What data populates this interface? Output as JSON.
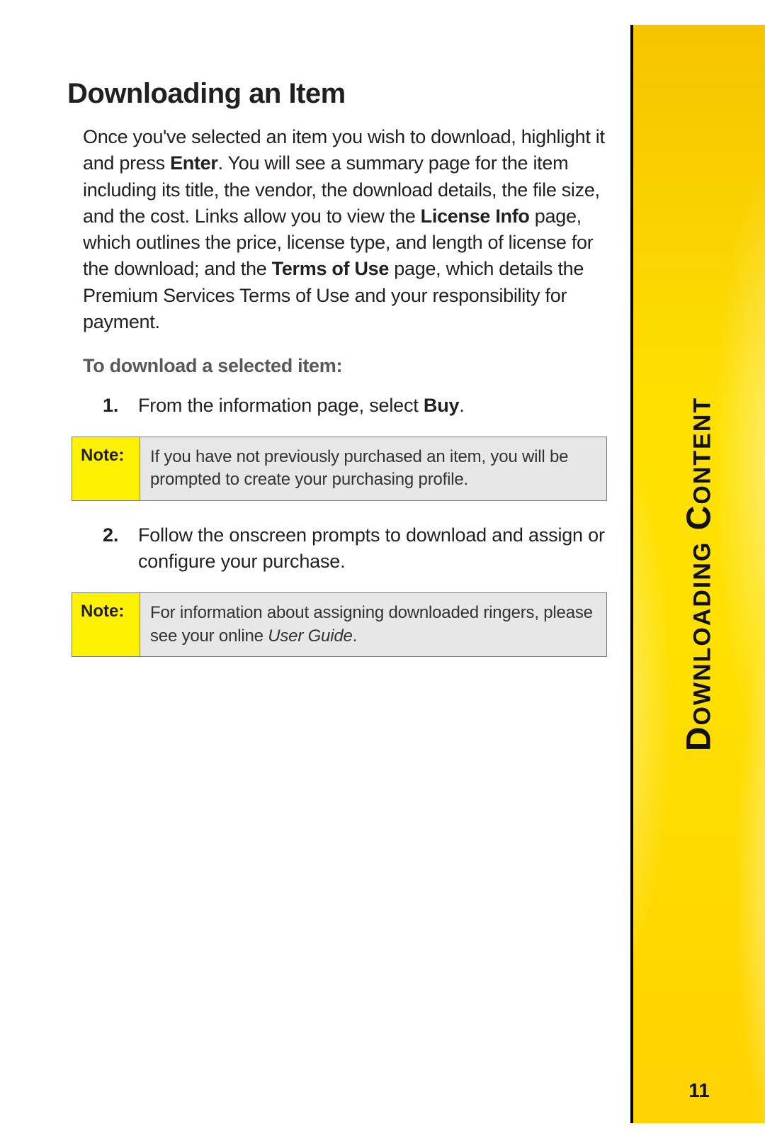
{
  "sidebar": {
    "section_label": "Downloading Content",
    "page_number": "11"
  },
  "heading": "Downloading an Item",
  "intro": {
    "seg1": "Once you've selected an item you wish to download, highlight it and press ",
    "bold1": "Enter",
    "seg2": ". You will see a summary page for the item including its title, the vendor, the download details, the file size, and the cost. Links allow you to view the ",
    "bold2": "License Info",
    "seg3": " page, which outlines the price, license type, and length of license for the download; and the ",
    "bold3": "Terms of Use",
    "seg4": " page, which details the Premium Services Terms of Use and your responsibility for payment."
  },
  "subhead": "To download a selected item:",
  "steps": [
    {
      "num": "1.",
      "pre": "From the information page, select ",
      "bold": "Buy",
      "post": "."
    },
    {
      "num": "2.",
      "pre": "Follow the onscreen prompts to download and assign or configure your purchase.",
      "bold": "",
      "post": ""
    }
  ],
  "notes": [
    {
      "label": "Note:",
      "text_pre": "If you have not previously purchased an item, you will be prompted to create your purchasing profile.",
      "italic": "",
      "text_post": ""
    },
    {
      "label": "Note:",
      "text_pre": "For information about assigning downloaded ringers, please see your online ",
      "italic": "User Guide",
      "text_post": "."
    }
  ]
}
